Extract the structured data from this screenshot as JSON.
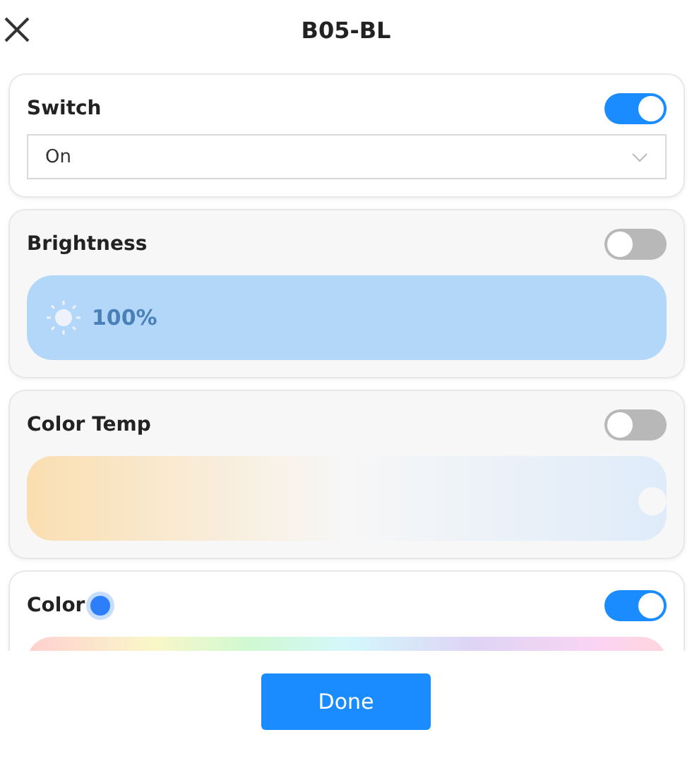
{
  "window": {
    "title": "B05-BL"
  },
  "sections": [
    {
      "kind": "select",
      "title": "Switch",
      "on": true,
      "value": "On"
    },
    {
      "kind": "brightness",
      "title": "Brightness",
      "on": false,
      "level": 1,
      "reading": "100%"
    },
    {
      "kind": "colortemp",
      "title": "Color Temp",
      "on": false,
      "level": 1
    },
    {
      "kind": "color",
      "title": "Color",
      "on": true,
      "color": "#2d7ff9"
    }
  ],
  "buttons": [
    "Done"
  ]
}
